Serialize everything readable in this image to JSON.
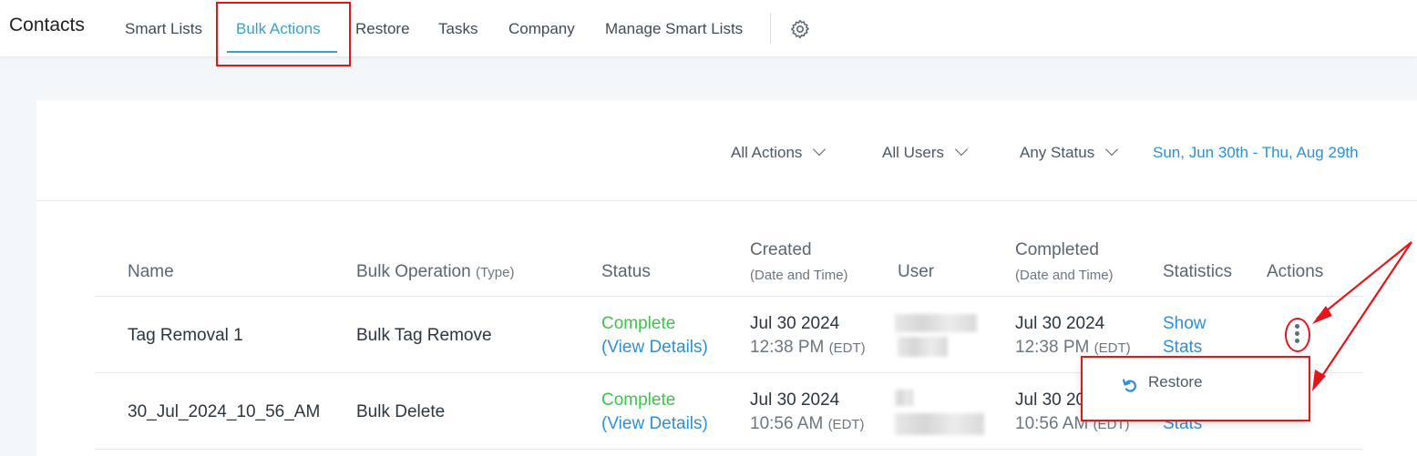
{
  "header": {
    "title": "Contacts",
    "tabs": [
      {
        "label": "Smart Lists",
        "active": false
      },
      {
        "label": "Bulk Actions",
        "active": true
      },
      {
        "label": "Restore",
        "active": false
      },
      {
        "label": "Tasks",
        "active": false
      },
      {
        "label": "Company",
        "active": false
      },
      {
        "label": "Manage Smart Lists",
        "active": false
      }
    ],
    "settings_icon": "gear-icon"
  },
  "filters": {
    "action": "All Actions",
    "user": "All Users",
    "status": "Any Status",
    "date_range": "Sun, Jun 30th - Thu, Aug 29th"
  },
  "table": {
    "columns": {
      "name": "Name",
      "operation": "Bulk Operation",
      "operation_sub": "(Type)",
      "status": "Status",
      "created": "Created",
      "created_sub": "(Date and Time)",
      "user": "User",
      "completed": "Completed",
      "completed_sub": "(Date and Time)",
      "statistics": "Statistics",
      "actions": "Actions"
    },
    "rows": [
      {
        "name": "Tag Removal 1",
        "operation": "Bulk Tag Remove",
        "status": "Complete",
        "status_link": "(View Details)",
        "created_date": "Jul 30 2024",
        "created_time": "12:38 PM",
        "created_tz": "(EDT)",
        "completed_date": "Jul 30 2024",
        "completed_time": "12:38 PM",
        "completed_tz": "(EDT)",
        "stats_line1": "Show",
        "stats_line2": "Stats"
      },
      {
        "name": "30_Jul_2024_10_56_AM",
        "operation": "Bulk Delete",
        "status": "Complete",
        "status_link": "(View Details)",
        "created_date": "Jul 30 2024",
        "created_time": "10:56 AM",
        "created_tz": "(EDT)",
        "completed_date": "Jul 30 2024",
        "completed_time": "10:56 AM",
        "completed_tz": "(EDT)",
        "stats_line2": "Stats"
      }
    ]
  },
  "actions_menu": {
    "items": [
      {
        "label": "Restore",
        "icon": "undo-icon"
      }
    ]
  },
  "colors": {
    "accent": "#3aa0c8",
    "link": "#2f8fd6",
    "success": "#3ec24a",
    "annotation": "#e4161b"
  }
}
